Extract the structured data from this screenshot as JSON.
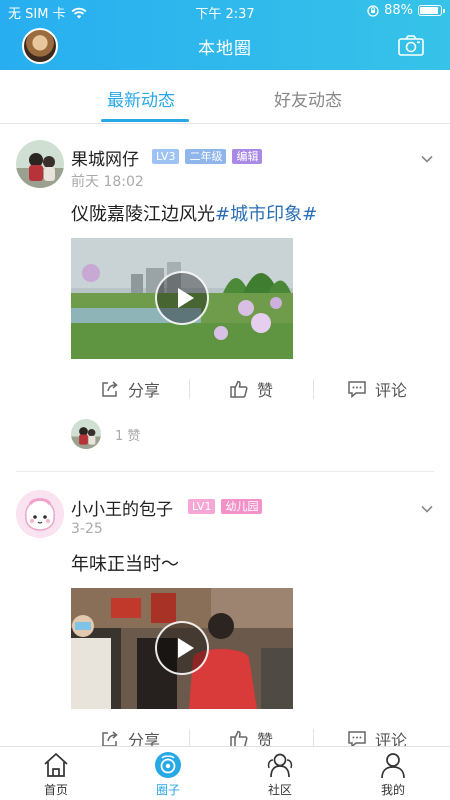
{
  "status_bar": {
    "carrier": "无 SIM 卡",
    "time": "下午 2:37",
    "battery": "88%",
    "battery_level": 0.88
  },
  "header": {
    "title": "本地圈",
    "avatar_icon": "user-avatar",
    "camera_icon": "camera-icon"
  },
  "tabs": [
    {
      "label": "最新动态",
      "active": true
    },
    {
      "label": "好友动态",
      "active": false
    }
  ],
  "posts": [
    {
      "user": "果城网仔",
      "badges": [
        {
          "text": "LV3",
          "color": "#9ec3f2"
        },
        {
          "text": "二年级",
          "color": "#8fb6ea"
        },
        {
          "text": "编辑",
          "color": "#a889e6"
        }
      ],
      "time": "前天 18:02",
      "text": "仪陇嘉陵江边风光",
      "tag": "#城市印象#",
      "likes_count": "1 赞"
    },
    {
      "user": "小小王的包子",
      "badges": [
        {
          "text": "LV1",
          "color": "#f6a7d6"
        },
        {
          "text": "幼儿园",
          "color": "#f292c9"
        }
      ],
      "time": "3-25",
      "text": "年味正当时～",
      "tag": ""
    }
  ],
  "actions": {
    "share": "分享",
    "like": "赞",
    "comment": "评论"
  },
  "bottom_nav": [
    {
      "label": "首页",
      "icon": "home-icon",
      "active": false
    },
    {
      "label": "圈子",
      "icon": "circle-icon",
      "active": true
    },
    {
      "label": "社区",
      "icon": "community-icon",
      "active": false
    },
    {
      "label": "我的",
      "icon": "profile-icon",
      "active": false
    }
  ],
  "colors": {
    "accent": "#29a8e6",
    "header_gradient_start": "#28aef0",
    "header_gradient_end": "#36c3e8",
    "tag": "#2a6fb6"
  }
}
